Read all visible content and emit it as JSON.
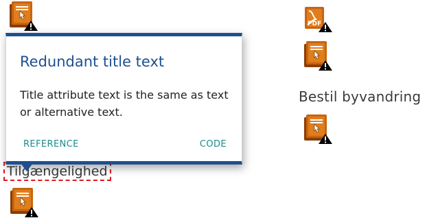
{
  "popup": {
    "title": "Redundant title text",
    "description": "Title attribute text is the same as text or alternative text.",
    "reference_label": "REFERENCE",
    "code_label": "CODE"
  },
  "page": {
    "bestil_text": "Bestil byvandring",
    "tilgaengelighed_text": "Tilgængelighed"
  },
  "colors": {
    "popup_accent": "#1d4f91",
    "link": "#1a8c8c",
    "icon_orange": "#c15a0c",
    "highlight": "#e2151f"
  },
  "icons": [
    "alert-icon",
    "pdf-alert-icon"
  ]
}
